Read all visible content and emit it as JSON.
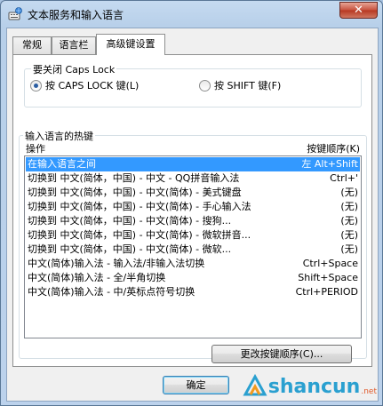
{
  "window": {
    "title": "文本服务和输入语言",
    "close_glyph": "✕",
    "icon": "keyboard-globe-icon"
  },
  "tabs": [
    {
      "label": "常规",
      "active": false
    },
    {
      "label": "语言栏",
      "active": false
    },
    {
      "label": "高级键设置",
      "active": true
    }
  ],
  "caps_group": {
    "title": "要关闭 Caps Lock",
    "options": [
      {
        "label": "按 CAPS LOCK 键(L)",
        "checked": true
      },
      {
        "label": "按 SHIFT 键(F)",
        "checked": false
      }
    ]
  },
  "hotkeys": {
    "group_title": "输入语言的热键",
    "col_action": "操作",
    "col_sequence": "按键顺序(K)",
    "rows": [
      {
        "action": "在输入语言之间",
        "key": "左 Alt+Shift",
        "selected": true
      },
      {
        "action": "切换到 中文(简体，中国) - 中文 - QQ拼音输入法",
        "key": "Ctrl+'",
        "selected": false
      },
      {
        "action": "切换到 中文(简体，中国) - 中文(简体) - 美式键盘",
        "key": "(无)",
        "selected": false
      },
      {
        "action": "切换到 中文(简体，中国) - 中文(简体) - 手心输入法",
        "key": "(无)",
        "selected": false
      },
      {
        "action": "切换到 中文(简体，中国) - 中文(简体) - 搜狗...",
        "key": "(无)",
        "selected": false
      },
      {
        "action": "切换到 中文(简体，中国) - 中文(简体) - 微软拼音...",
        "key": "(无)",
        "selected": false
      },
      {
        "action": "切换到 中文(简体，中国) - 中文(简体) - 微软...",
        "key": "(无)",
        "selected": false
      },
      {
        "action": "中文(简体)输入法 - 输入法/非输入法切换",
        "key": "Ctrl+Space",
        "selected": false
      },
      {
        "action": "中文(简体)输入法 - 全/半角切换",
        "key": "Shift+Space",
        "selected": false
      },
      {
        "action": "中文(简体)输入法 - 中/英标点符号切换",
        "key": "Ctrl+PERIOD",
        "selected": false
      }
    ],
    "change_button": "更改按键顺序(C)..."
  },
  "footer": {
    "ok_label": "确定"
  },
  "watermark": {
    "text": "shancun",
    "suffix": ".net"
  },
  "colors": {
    "selection": "#3399ff",
    "close_button": "#c7513e",
    "watermark": "#2aa0d0"
  }
}
